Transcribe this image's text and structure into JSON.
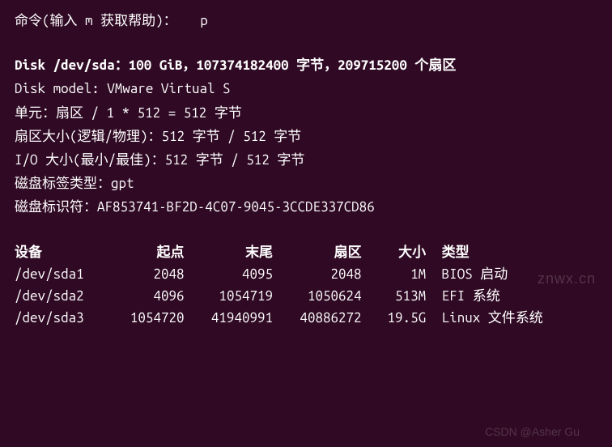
{
  "prompt": {
    "label": "命令(输入 m 获取帮助)：",
    "input": "p"
  },
  "disk": {
    "header": "Disk /dev/sda：100 GiB，107374182400 字节，209715200 个扇区",
    "model": "Disk model: VMware Virtual S",
    "unit": "单元：扇区 / 1 * 512 = 512 字节",
    "sector_size": "扇区大小(逻辑/物理)：512 字节 / 512 字节",
    "io_size": "I/O 大小(最小/最佳)：512 字节 / 512 字节",
    "label_type": "磁盘标签类型：gpt",
    "identifier": "磁盘标识符：AF853741-BF2D-4C07-9045-3CCDE337CD86"
  },
  "partition_table": {
    "headers": {
      "device": "设备",
      "start": "起点",
      "end": "末尾",
      "sectors": "扇区",
      "size": "大小",
      "type": "类型"
    },
    "rows": [
      {
        "device": "/dev/sda1",
        "start": "2048",
        "end": "4095",
        "sectors": "2048",
        "size": "1M",
        "type": "BIOS 启动"
      },
      {
        "device": "/dev/sda2",
        "start": "4096",
        "end": "1054719",
        "sectors": "1050624",
        "size": "513M",
        "type": "EFI 系统"
      },
      {
        "device": "/dev/sda3",
        "start": "1054720",
        "end": "41940991",
        "sectors": "40886272",
        "size": "19.5G",
        "type": "Linux 文件系统"
      }
    ]
  },
  "watermarks": {
    "w1": "znwx.cn",
    "w2": "CSDN @Asher Gu"
  }
}
